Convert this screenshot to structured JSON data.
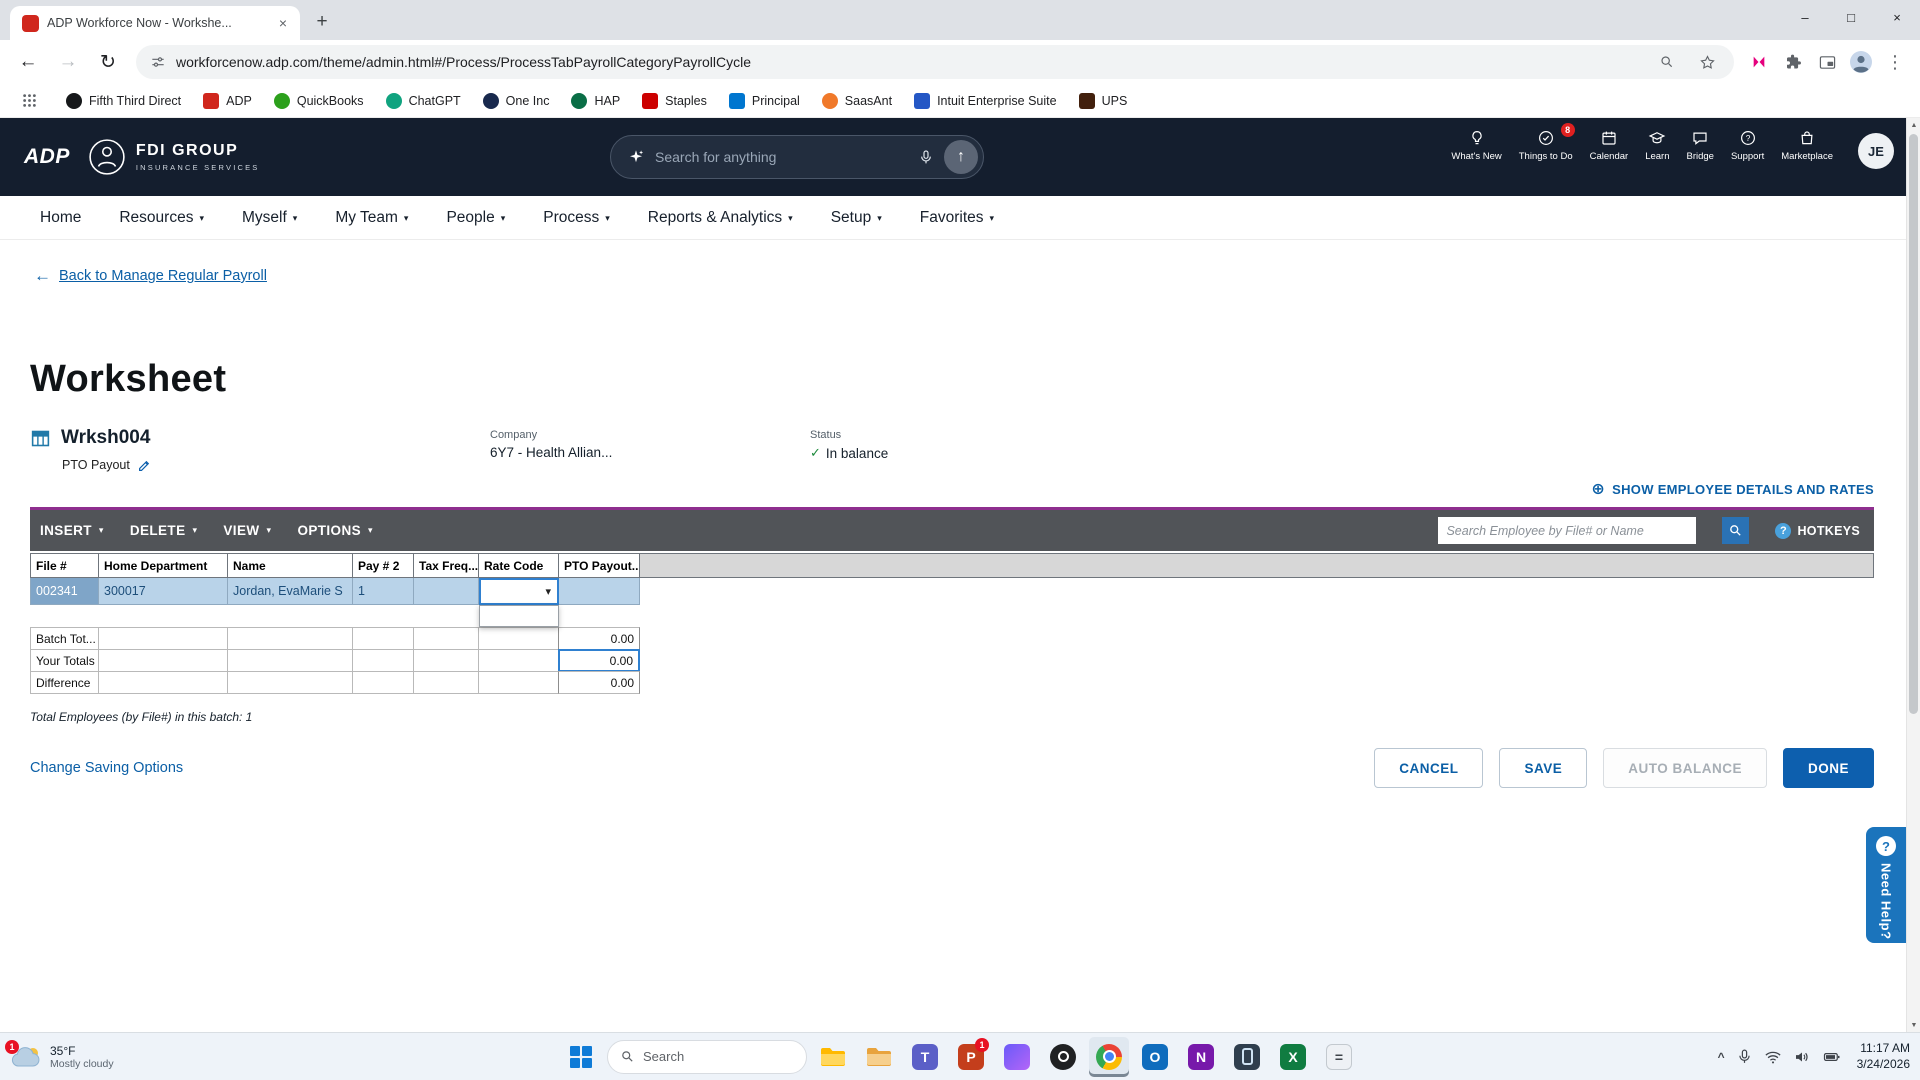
{
  "browser": {
    "tab_title": "ADP Workforce Now - Workshe...",
    "url": "workforcenow.adp.com/theme/admin.html#/Process/ProcessTabPayrollCategoryPayrollCycle",
    "bookmarks": [
      "Fifth Third Direct",
      "ADP",
      "QuickBooks",
      "ChatGPT",
      "One Inc",
      "HAP",
      "Staples",
      "Principal",
      "SaasAnt",
      "Intuit Enterprise Suite",
      "UPS"
    ]
  },
  "header": {
    "adp_logo": "ADP",
    "brand_name": "FDI GROUP",
    "brand_tagline": "INSURANCE SERVICES",
    "search_placeholder": "Search for anything",
    "icon_labels": [
      "What's New",
      "Things to Do",
      "Calendar",
      "Learn",
      "Bridge",
      "Support",
      "Marketplace"
    ],
    "things_to_do_badge": "8",
    "avatar_initials": "JE"
  },
  "nav": {
    "items": [
      "Home",
      "Resources",
      "Myself",
      "My Team",
      "People",
      "Process",
      "Reports & Analytics",
      "Setup",
      "Favorites"
    ]
  },
  "page": {
    "back_link": "Back to Manage Regular Payroll",
    "title": "Worksheet",
    "worksheet_id": "Wrksh004",
    "worksheet_type": "PTO Payout",
    "company_label": "Company",
    "company_value": "6Y7 - Health Allian...",
    "status_label": "Status",
    "status_value": "In balance",
    "show_details": "SHOW EMPLOYEE DETAILS AND RATES"
  },
  "toolbar": {
    "insert": "INSERT",
    "delete": "DELETE",
    "view": "VIEW",
    "options": "OPTIONS",
    "search_placeholder": "Search Employee by File# or Name",
    "hotkeys": "HOTKEYS"
  },
  "grid": {
    "columns": [
      "File #",
      "Home Department",
      "Name",
      "Pay # 2",
      "Tax Freq...",
      "Rate Code",
      "PTO Payout..."
    ],
    "row": {
      "file_number": "002341",
      "home_department": "300017",
      "employee_name": "Jordan, EvaMarie S",
      "pay_2": "1"
    },
    "totals_labels": [
      "Batch Tot...",
      "Your Totals",
      "Difference"
    ],
    "totals_values": [
      "0.00",
      "0.00",
      "0.00"
    ],
    "footnote": "Total Employees (by File#) in this batch: 1"
  },
  "footer": {
    "change_saving": "Change Saving Options",
    "cancel": "CANCEL",
    "save": "SAVE",
    "auto_balance": "AUTO BALANCE",
    "done": "DONE"
  },
  "help": {
    "label": "Need Help?"
  },
  "taskbar": {
    "weather_temp": "35°F",
    "weather_desc": "Mostly cloudy",
    "weather_badge": "1",
    "search_placeholder": "Search",
    "powerpoint_badge": "1",
    "time": "11:17 AM",
    "date": "3/24/2026"
  }
}
